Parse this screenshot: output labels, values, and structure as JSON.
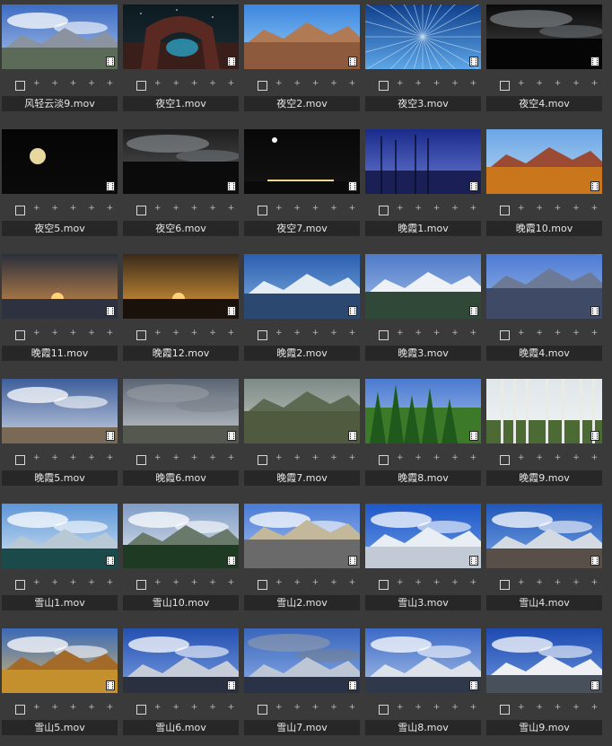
{
  "rating_placeholder": "+ + + + +",
  "items": [
    {
      "label": "风轻云淡9.mov",
      "thumb": {
        "sky": [
          "#3d6cc4",
          "#a9c2e6"
        ],
        "land": "#5c6a58",
        "land_h": 24,
        "cloud": true,
        "mountain": "#8b93a0"
      }
    },
    {
      "label": "夜空1.mov",
      "thumb": {
        "sky": [
          "#0c1a22",
          "#1d2d33"
        ],
        "land": "#3a1e1a",
        "land_h": 30,
        "arch": true,
        "stars": true
      }
    },
    {
      "label": "夜空2.mov",
      "thumb": {
        "sky": [
          "#3b86e0",
          "#9fd0f4"
        ],
        "land": "#8d5a3e",
        "land_h": 30,
        "mountain": "#b07a55"
      }
    },
    {
      "label": "夜空3.mov",
      "thumb": {
        "sky": [
          "#0f3f8c",
          "#5da6e8"
        ],
        "land": "#0f3f8c",
        "land_h": 0,
        "trees_radial": true
      }
    },
    {
      "label": "夜空4.mov",
      "thumb": {
        "sky": [
          "#0a0a0a",
          "#4a4a4a"
        ],
        "land": "#050505",
        "land_h": 34,
        "cloud_dark": true
      }
    },
    {
      "label": "夜空5.mov",
      "thumb": {
        "sky": [
          "#050505",
          "#0a0a0a"
        ],
        "land": "#050505",
        "land_h": 0,
        "moon": true
      }
    },
    {
      "label": "夜空6.mov",
      "thumb": {
        "sky": [
          "#1e1e1e",
          "#5a5a5a"
        ],
        "land": "#0b0b0b",
        "land_h": 36,
        "cloud_dark": true
      }
    },
    {
      "label": "夜空7.mov",
      "thumb": {
        "sky": [
          "#070707",
          "#141414"
        ],
        "land": "#0a0a0a",
        "land_h": 14,
        "moon_small": true,
        "lights": true
      }
    },
    {
      "label": "晚霞1.mov",
      "thumb": {
        "sky": [
          "#1a2a8a",
          "#6c7ed8"
        ],
        "land": "#1a1f55",
        "land_h": 26,
        "bare_trees": true
      }
    },
    {
      "label": "晚霞10.mov",
      "thumb": {
        "sky": [
          "#6aa6e6",
          "#bcd9f2"
        ],
        "land": "#c9761c",
        "land_h": 30,
        "mountain": "#9b4a34"
      }
    },
    {
      "label": "晚霞11.mov",
      "thumb": {
        "sky": [
          "#2a2f3c",
          "#d7924a"
        ],
        "land": "#2d3140",
        "land_h": 22,
        "sun": true
      }
    },
    {
      "label": "晚霞12.mov",
      "thumb": {
        "sky": [
          "#3a2a1a",
          "#e6a03a"
        ],
        "land": "#1a120a",
        "land_h": 22,
        "sun": true
      }
    },
    {
      "label": "晚霞2.mov",
      "thumb": {
        "sky": [
          "#2a5fb0",
          "#86b2e2"
        ],
        "land": "#2a4870",
        "land_h": 28,
        "mountain": "#e4ecf4"
      }
    },
    {
      "label": "晚霞3.mov",
      "thumb": {
        "sky": [
          "#4f7ac8",
          "#a6c4ec"
        ],
        "land": "#2f4838",
        "land_h": 30,
        "mountain": "#eef2f6"
      }
    },
    {
      "label": "晚霞4.mov",
      "thumb": {
        "sky": [
          "#4d7ad4",
          "#9fbde8"
        ],
        "land": "#3f4a66",
        "land_h": 34,
        "mountain": "#6c7a96"
      }
    },
    {
      "label": "晚霞5.mov",
      "thumb": {
        "sky": [
          "#3e5e9a",
          "#c8d2e2"
        ],
        "land": "#7a6a55",
        "land_h": 18,
        "cloud": true
      }
    },
    {
      "label": "晚霞6.mov",
      "thumb": {
        "sky": [
          "#5a6472",
          "#c6ccd4"
        ],
        "land": "#54584e",
        "land_h": 20,
        "cloud_dark": true
      }
    },
    {
      "label": "晚霞7.mov",
      "thumb": {
        "sky": [
          "#7d8a86",
          "#c8cdc6"
        ],
        "land": "#4f5a3e",
        "land_h": 36,
        "mountain": "#5d6a52"
      }
    },
    {
      "label": "晚霞8.mov",
      "thumb": {
        "sky": [
          "#4c7ad0",
          "#a8c6ee"
        ],
        "land": "#3c7a2a",
        "land_h": 40,
        "pines": true
      }
    },
    {
      "label": "晚霞9.mov",
      "thumb": {
        "sky": [
          "#dfe6ea",
          "#f2f4f5"
        ],
        "land": "#4c6a34",
        "land_h": 26,
        "birches": true
      }
    },
    {
      "label": "雪山1.mov",
      "thumb": {
        "sky": [
          "#5d96d8",
          "#d6e6f2"
        ],
        "land": "#1a4a4a",
        "land_h": 22,
        "mountain": "#b8c8d4",
        "cloud": true
      }
    },
    {
      "label": "雪山10.mov",
      "thumb": {
        "sky": [
          "#7e9cc6",
          "#e4e8ec"
        ],
        "land": "#1e3a22",
        "land_h": 26,
        "mountain": "#6a7a6a",
        "cloud": true
      }
    },
    {
      "label": "雪山2.mov",
      "thumb": {
        "sky": [
          "#4a7ad6",
          "#a9c4ee"
        ],
        "land": "#6a6a6a",
        "land_h": 32,
        "mountain": "#c4b89c",
        "cloud": true
      }
    },
    {
      "label": "雪山3.mov",
      "thumb": {
        "sky": [
          "#1e58c8",
          "#6a9ae6"
        ],
        "land": "#c2cad6",
        "land_h": 24,
        "mountain": "#e8eef4",
        "cloud": true
      }
    },
    {
      "label": "雪山4.mov",
      "thumb": {
        "sky": [
          "#2056b8",
          "#78a6e4"
        ],
        "land": "#585048",
        "land_h": 22,
        "mountain": "#d4dae2",
        "cloud": true
      }
    },
    {
      "label": "雪山5.mov",
      "thumb": {
        "sky": [
          "#3a6ab8",
          "#dcb86a"
        ],
        "land": "#c4902e",
        "land_h": 26,
        "mountain": "#a46a2a",
        "cloud": true
      }
    },
    {
      "label": "雪山6.mov",
      "thumb": {
        "sky": [
          "#2450b0",
          "#7a9ee2"
        ],
        "land": "#2a3040",
        "land_h": 18,
        "mountain": "#c6ccd8",
        "cloud": true
      }
    },
    {
      "label": "雪山7.mov",
      "thumb": {
        "sky": [
          "#3a66bc",
          "#8aace6"
        ],
        "land": "#2a3248",
        "land_h": 18,
        "mountain": "#bcc6d4",
        "cloud_dark": true
      }
    },
    {
      "label": "雪山8.mov",
      "thumb": {
        "sky": [
          "#3c6ac6",
          "#a8c0e8"
        ],
        "land": "#30384c",
        "land_h": 18,
        "mountain": "#dde2ea",
        "cloud": true
      }
    },
    {
      "label": "雪山9.mov",
      "thumb": {
        "sky": [
          "#1c4ab0",
          "#6c94de"
        ],
        "land": "#48505c",
        "land_h": 20,
        "mountain": "#eef0f4",
        "cloud": true
      }
    }
  ]
}
